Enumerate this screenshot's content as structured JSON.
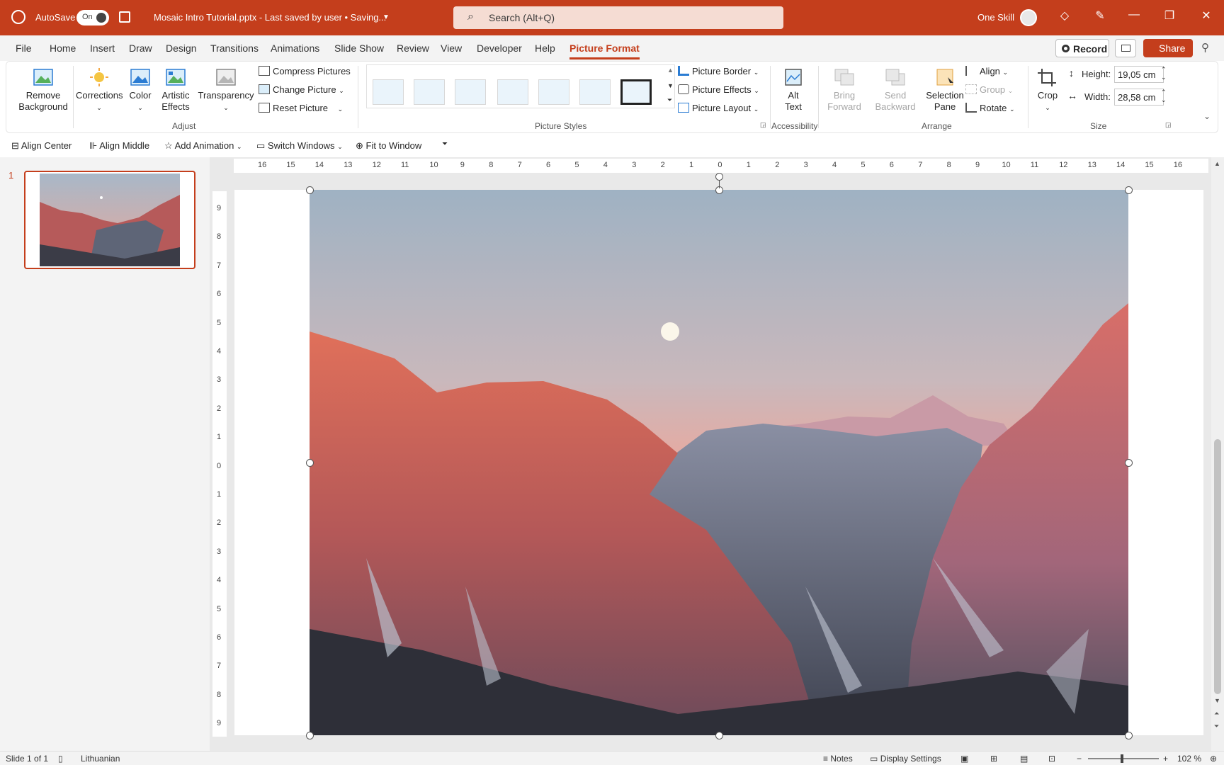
{
  "titlebar": {
    "autosave_label": "AutoSave",
    "autosave_state": "On",
    "doc_title": "Mosaic Intro Tutorial.pptx  -  Last saved by user • Saving...",
    "search_placeholder": "Search (Alt+Q)",
    "user_name": "One Skill"
  },
  "menu": {
    "tabs": [
      "File",
      "Home",
      "Insert",
      "Draw",
      "Design",
      "Transitions",
      "Animations",
      "Slide Show",
      "Review",
      "View",
      "Developer",
      "Help",
      "Picture Format"
    ],
    "active_tab": "Picture Format",
    "record_label": "Record",
    "share_label": "Share"
  },
  "ribbon": {
    "adjust": {
      "remove_background": [
        "Remove",
        "Background"
      ],
      "corrections": "Corrections",
      "color": "Color",
      "artistic_effects": [
        "Artistic",
        "Effects"
      ],
      "transparency": "Transparency",
      "compress": "Compress Pictures",
      "change": "Change Picture",
      "reset": "Reset Picture",
      "group_label": "Adjust"
    },
    "picture_styles": {
      "border": "Picture Border",
      "effects": "Picture Effects",
      "layout": "Picture Layout",
      "group_label": "Picture Styles"
    },
    "accessibility": {
      "alt_text": [
        "Alt",
        "Text"
      ],
      "group_label": "Accessibility"
    },
    "arrange": {
      "bring_forward": [
        "Bring",
        "Forward"
      ],
      "send_backward": [
        "Send",
        "Backward"
      ],
      "selection_pane": [
        "Selection",
        "Pane"
      ],
      "align": "Align",
      "group": "Group",
      "rotate": "Rotate",
      "group_label": "Arrange"
    },
    "size": {
      "crop": "Crop",
      "height_label": "Height:",
      "height_value": "19,05 cm",
      "width_label": "Width:",
      "width_value": "28,58 cm",
      "group_label": "Size"
    }
  },
  "qat": {
    "align_center": "Align Center",
    "align_middle": "Align Middle",
    "add_animation": "Add Animation",
    "switch_windows": "Switch Windows",
    "fit_to_window": "Fit to Window"
  },
  "thumbnails": {
    "slide_number": "1"
  },
  "rulers": {
    "horizontal": [
      "16",
      "15",
      "14",
      "13",
      "12",
      "11",
      "10",
      "9",
      "8",
      "7",
      "6",
      "5",
      "4",
      "3",
      "2",
      "1",
      "0",
      "1",
      "2",
      "3",
      "4",
      "5",
      "6",
      "7",
      "8",
      "9",
      "10",
      "11",
      "12",
      "13",
      "14",
      "15",
      "16"
    ],
    "vertical": [
      "9",
      "8",
      "7",
      "6",
      "5",
      "4",
      "3",
      "2",
      "1",
      "0",
      "1",
      "2",
      "3",
      "4",
      "5",
      "6",
      "7",
      "8",
      "9"
    ]
  },
  "statusbar": {
    "slide_info": "Slide 1 of 1",
    "language": "Lithuanian",
    "notes": "Notes",
    "display_settings": "Display Settings",
    "zoom": "102 %"
  },
  "colors": {
    "accent": "#c43e1c"
  }
}
